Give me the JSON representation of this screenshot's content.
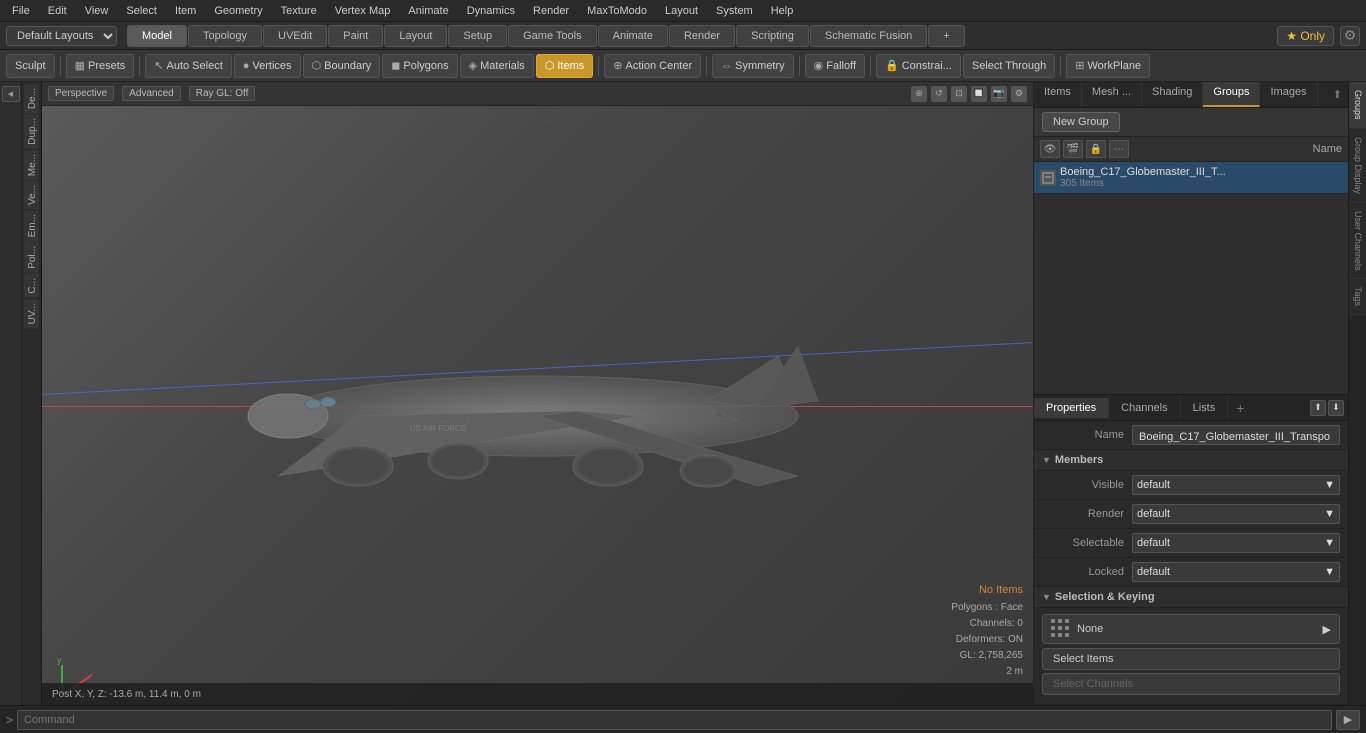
{
  "menubar": {
    "items": [
      {
        "label": "File"
      },
      {
        "label": "Edit"
      },
      {
        "label": "View"
      },
      {
        "label": "Select"
      },
      {
        "label": "Item"
      },
      {
        "label": "Geometry"
      },
      {
        "label": "Texture"
      },
      {
        "label": "Vertex Map"
      },
      {
        "label": "Animate"
      },
      {
        "label": "Dynamics"
      },
      {
        "label": "Render"
      },
      {
        "label": "MaxToModo"
      },
      {
        "label": "Layout"
      },
      {
        "label": "System"
      },
      {
        "label": "Help"
      }
    ]
  },
  "layout_bar": {
    "layout_select": "Default Layouts",
    "tabs": [
      {
        "label": "Model",
        "active": true
      },
      {
        "label": "Topology"
      },
      {
        "label": "UVEdit"
      },
      {
        "label": "Paint"
      },
      {
        "label": "Layout"
      },
      {
        "label": "Setup"
      },
      {
        "label": "Game Tools"
      },
      {
        "label": "Animate"
      },
      {
        "label": "Render"
      },
      {
        "label": "Scripting",
        "active": false
      },
      {
        "label": "Schematic Fusion"
      }
    ],
    "star_label": "★ Only",
    "plus_label": "+"
  },
  "toolbar": {
    "sculpt_label": "Sculpt",
    "presets_label": "Presets",
    "buttons": [
      {
        "label": "Auto Select",
        "icon": "cursor"
      },
      {
        "label": "Vertices",
        "icon": "dot"
      },
      {
        "label": "Boundary",
        "icon": "boundary"
      },
      {
        "label": "Polygons",
        "icon": "polygon"
      },
      {
        "label": "Materials",
        "icon": "material"
      },
      {
        "label": "Items",
        "icon": "item",
        "active": true
      },
      {
        "label": "Action Center",
        "icon": "center"
      },
      {
        "label": "Symmetry",
        "icon": "symmetry"
      },
      {
        "label": "Falloff",
        "icon": "falloff"
      },
      {
        "label": "Constrai...",
        "icon": "constraint"
      },
      {
        "label": "Select Through",
        "icon": "through"
      },
      {
        "label": "WorkPlane",
        "icon": "workplane"
      }
    ]
  },
  "viewport": {
    "mode": "Perspective",
    "shading": "Advanced",
    "ray_gl": "Ray GL: Off",
    "info": {
      "no_items": "No Items",
      "polygons": "Polygons : Face",
      "channels": "Channels: 0",
      "deformers": "Deformers: ON",
      "gl_count": "GL: 2,758,265",
      "scale": "2 m"
    },
    "status": "Post X, Y, Z:  -13.6 m, 11.4 m, 0 m"
  },
  "left_sidebar_tabs": [
    {
      "label": "De..."
    },
    {
      "label": "Dup..."
    },
    {
      "label": "Me..."
    },
    {
      "label": "Ve..."
    },
    {
      "label": "Em..."
    },
    {
      "label": "Pol..."
    },
    {
      "label": "C..."
    },
    {
      "label": "UV..."
    }
  ],
  "right_panel": {
    "group_tabs": [
      {
        "label": "Items",
        "active": false
      },
      {
        "label": "Mesh ...",
        "active": false
      },
      {
        "label": "Shading",
        "active": false
      },
      {
        "label": "Groups",
        "active": true
      },
      {
        "label": "Images",
        "active": false
      }
    ],
    "new_group_label": "New Group",
    "name_col_label": "Name",
    "group_item": {
      "name": "Boeing_C17_Globemaster_III_T...",
      "count_label": "305 Items"
    },
    "properties": {
      "tabs": [
        {
          "label": "Properties",
          "active": true
        },
        {
          "label": "Channels"
        },
        {
          "label": "Lists"
        }
      ],
      "name_label": "Name",
      "name_value": "Boeing_C17_Globemaster_III_Transpo",
      "members_section": "Members",
      "fields": [
        {
          "label": "Visible",
          "value": "default"
        },
        {
          "label": "Render",
          "value": "default"
        },
        {
          "label": "Selectable",
          "value": "default"
        },
        {
          "label": "Locked",
          "value": "default"
        }
      ],
      "selection_section": "Selection & Keying",
      "none_label": "None",
      "select_items_label": "Select Items",
      "select_channels_label": "Select Channels"
    }
  },
  "right_vtabs": [
    {
      "label": "Groups"
    },
    {
      "label": "Group Display"
    },
    {
      "label": "User Channels"
    },
    {
      "label": "Tags"
    }
  ],
  "command_bar": {
    "expand_label": ">",
    "placeholder": "Command",
    "run_label": "▶"
  }
}
